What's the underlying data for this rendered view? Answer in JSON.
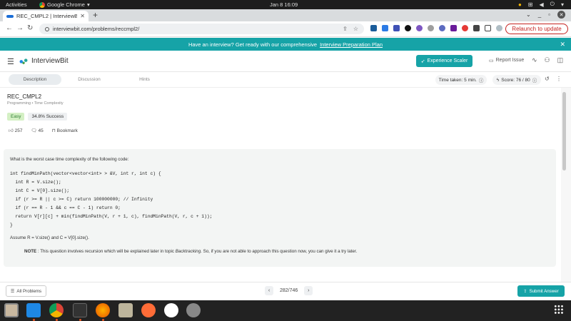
{
  "system": {
    "activities": "Activities",
    "app_name": "Google Chrome",
    "clock": "Jan 8  16:09"
  },
  "browser": {
    "tab_title": "REC_CMPL2 | InterviewBit",
    "url": "interviewbit.com/problems/reccmpl2/",
    "relaunch_label": "Relaunch to update"
  },
  "banner": {
    "text": "Have an interview? Get ready with our comprehensive",
    "link": "Interview Preparation Plan"
  },
  "header": {
    "logo_text": "InterviewBit",
    "experience_button": "Experience Scaler",
    "report_issue": "Report Issue"
  },
  "question_tabs": {
    "description": "Description",
    "discussion": "Discussion",
    "hints": "Hints",
    "timer": "Time taken: 5 min.",
    "score": "Score:  76  /  80"
  },
  "problem": {
    "title": "REC_CMPL2",
    "breadcrumb": "Programming • Time Complexity",
    "difficulty": "Easy",
    "success_rate": "34.8% Success",
    "upvotes": "257",
    "comments": "45",
    "bookmark": "Bookmark",
    "question": "What is the worst case time complexity of the following code:",
    "code": "int findMinPath(vector<vector<int> > &V, int r, int c) {\n  int R = V.size();\n  int C = V[0].size();\n  if (r >= R || c >= C) return 100000000; // Infinity\n  if (r == R - 1 && c == C - 1) return 0;\n  return V[r][c] + min(findMinPath(V, r + 1, c), findMinPath(V, r, c + 1));\n}",
    "assumption": "Assume R = V.size() and C = V[0].size().",
    "note_label": "NOTE",
    "note_text_before": " : This question involves recursion which will be explained later in topic ",
    "note_topic": "Backtracking",
    "note_text_after": ". So, if you are not able to approach this question now, you can give it a try later."
  },
  "footer": {
    "all_problems": "All Problems",
    "pagination": "282/746",
    "submit": "Submit Answer"
  }
}
